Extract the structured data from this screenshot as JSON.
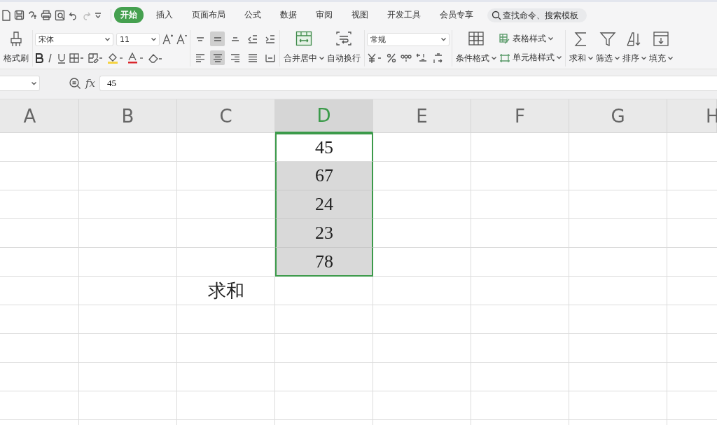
{
  "menu_tabs": [
    {
      "label": "开始",
      "selected": true
    },
    {
      "label": "插入",
      "selected": false
    },
    {
      "label": "页面布局",
      "selected": false
    },
    {
      "label": "公式",
      "selected": false
    },
    {
      "label": "数据",
      "selected": false
    },
    {
      "label": "审阅",
      "selected": false
    },
    {
      "label": "视图",
      "selected": false
    },
    {
      "label": "开发工具",
      "selected": false
    },
    {
      "label": "会员专享",
      "selected": false
    }
  ],
  "search": {
    "placeholder": "查找命令、搜索模板"
  },
  "ribbon": {
    "format_painter": "格式刷",
    "font_name": "宋体",
    "font_size": "11",
    "merge_center": "合并居中",
    "wrap_text": "自动换行",
    "number_format": "常规",
    "conditional_format": "条件格式",
    "table_style": "表格样式",
    "cell_style": "单元格样式",
    "tools": [
      {
        "kind": "sum",
        "label": "求和"
      },
      {
        "kind": "filter",
        "label": "筛选"
      },
      {
        "kind": "sort",
        "label": "排序"
      },
      {
        "kind": "fill",
        "label": "填充"
      }
    ],
    "align_buttons": [
      {
        "kind": "top",
        "selected": false
      },
      {
        "kind": "middle",
        "selected": true
      },
      {
        "kind": "bottom",
        "selected": false
      },
      {
        "kind": "outdent",
        "selected": false
      },
      {
        "kind": "indent",
        "selected": false
      },
      {
        "kind": "left",
        "selected": false
      },
      {
        "kind": "center",
        "selected": true
      },
      {
        "kind": "right",
        "selected": false
      },
      {
        "kind": "justify",
        "selected": false
      },
      {
        "kind": "distributed",
        "selected": false
      }
    ]
  },
  "formula_bar": {
    "function_label": "fx",
    "value": "45"
  },
  "sheet": {
    "columns": [
      {
        "label": "A",
        "selected": false
      },
      {
        "label": "B",
        "selected": false
      },
      {
        "label": "C",
        "selected": false
      },
      {
        "label": "D",
        "selected": true
      },
      {
        "label": "E",
        "selected": false
      },
      {
        "label": "F",
        "selected": false
      },
      {
        "label": "G",
        "selected": false
      },
      {
        "label": "H",
        "selected": false
      }
    ],
    "rows": [
      {
        "cells": {
          "D": "45"
        },
        "selected": true,
        "active": true
      },
      {
        "cells": {
          "D": "67"
        },
        "selected": true,
        "active": false
      },
      {
        "cells": {
          "D": "24"
        },
        "selected": true,
        "active": false
      },
      {
        "cells": {
          "D": "23"
        },
        "selected": true,
        "active": false
      },
      {
        "cells": {
          "D": "78"
        },
        "selected": true,
        "active": false
      },
      {
        "cells": {
          "C": "求和"
        },
        "selected": false,
        "active": false
      }
    ]
  }
}
